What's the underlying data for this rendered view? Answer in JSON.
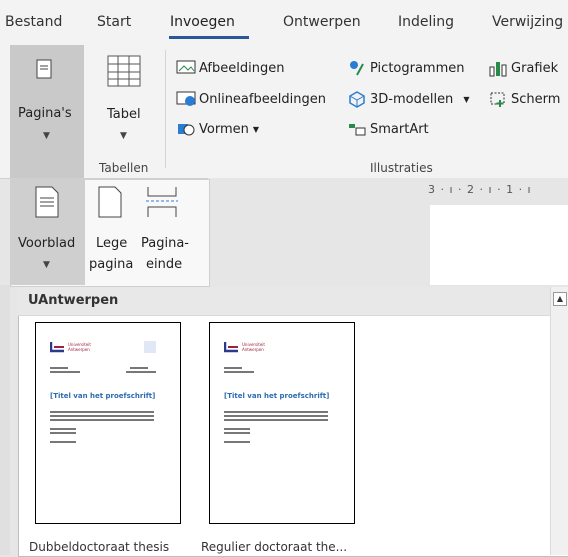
{
  "tabs": [
    "Bestand",
    "Start",
    "Invoegen",
    "Ontwerpen",
    "Indeling",
    "Verwijzing"
  ],
  "ribbon": {
    "pages_label": "Pagina's",
    "table_label": "Tabel",
    "tables_group": "Tabellen",
    "illustrations_group": "Illustraties",
    "afbeeldingen": "Afbeeldingen",
    "onlineafbeeldingen": "Onlineafbeeldingen",
    "vormen": "Vormen",
    "pictogrammen": "Pictogrammen",
    "modellen3d": "3D-modellen",
    "smartart": "SmartArt",
    "grafiek": "Grafiek",
    "scherm": "Scherm"
  },
  "pages_menu": {
    "voorblad": "Voorblad",
    "lege_1": "Lege",
    "lege_2": "pagina",
    "einde_1": "Pagina-",
    "einde_2": "einde"
  },
  "ruler": "3 · ı · 2 · ı · 1 · ı",
  "gallery": {
    "header": "UAntwerpen",
    "items": [
      {
        "caption": "Dubbeldoctoraat thesis",
        "title": "[Titel van het proefschrift]",
        "logo_1": "Universiteit",
        "logo_2": "Antwerpen"
      },
      {
        "caption": "Regulier doctoraat the...",
        "title": "[Titel van het proefschrift]",
        "logo_1": "Universiteit",
        "logo_2": "Antwerpen"
      }
    ]
  },
  "colors": {
    "accent": "#2b579a",
    "selected": "#c9c9c9",
    "logo": "#a02040",
    "thumb_title": "#2b6cb0"
  }
}
